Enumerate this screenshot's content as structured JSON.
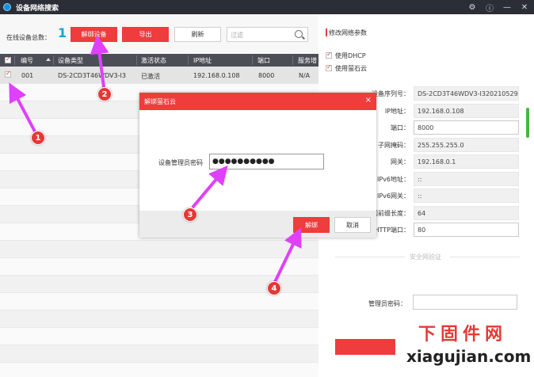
{
  "window": {
    "title": "设备网络搜索",
    "buttons": [
      "gear-icon",
      "info-icon",
      "minimize-icon",
      "close-icon"
    ],
    "button_glyphs": [
      "⚙",
      "ⓘ",
      "—",
      "✕"
    ]
  },
  "toolbar": {
    "online_label": "在线设备总数：",
    "online_count": "1",
    "unbind_label": "解绑设备",
    "export_label": "导出",
    "refresh_label": "刷新",
    "filter_placeholder": "过滤"
  },
  "table": {
    "headers": [
      "编号",
      "设备类型",
      "激活状态",
      "IP地址",
      "端口",
      "服务增"
    ],
    "rows": [
      [
        "001",
        "DS-2CD3T46WDV3-I3",
        "已激活",
        "192.168.0.108",
        "8000",
        "N/A"
      ]
    ]
  },
  "dialog": {
    "title": "解绑萤石云",
    "close_glyph": "×",
    "password_label": "设备管理员密码",
    "password_value": "●●●●●●●●●●",
    "ok_label": "解绑",
    "cancel_label": "取消"
  },
  "panel": {
    "title": "修改网络参数",
    "checkboxes": [
      "使用DHCP",
      "使用萤石云"
    ],
    "fields": [
      {
        "label": "设备序列号：",
        "value": "DS-2CD3T46WDV3-I320210529AA",
        "type": "ro"
      },
      {
        "label": "IP地址：",
        "value": "192.168.0.108",
        "type": "ro"
      },
      {
        "label": "端口：",
        "value": "8000",
        "type": "ed"
      },
      {
        "label": "子网掩码：",
        "value": "255.255.255.0",
        "type": "ro"
      },
      {
        "label": "网关：",
        "value": "192.168.0.1",
        "type": "ro"
      },
      {
        "label": "IPv6地址：",
        "value": "::",
        "type": "ro"
      },
      {
        "label": "IPv6网关：",
        "value": "::",
        "type": "ro"
      },
      {
        "label": "IPv6子网前缀长度：",
        "value": "64",
        "type": "ro"
      },
      {
        "label": "HTTP端口：",
        "value": "80",
        "type": "ed"
      }
    ],
    "security_title": "安全网验证",
    "admin_password_label": "管理员密码："
  },
  "annotations": [
    "1",
    "1",
    "2",
    "3",
    "4"
  ],
  "watermark": {
    "cn": "下固件网",
    "en": "xiagujian.com"
  },
  "colors": {
    "accent": "#ef3c3c",
    "titlebar": "#2b2e37",
    "table_header": "#4b4e56",
    "arrow": "#e040fb",
    "count": "#1e9fd8"
  }
}
